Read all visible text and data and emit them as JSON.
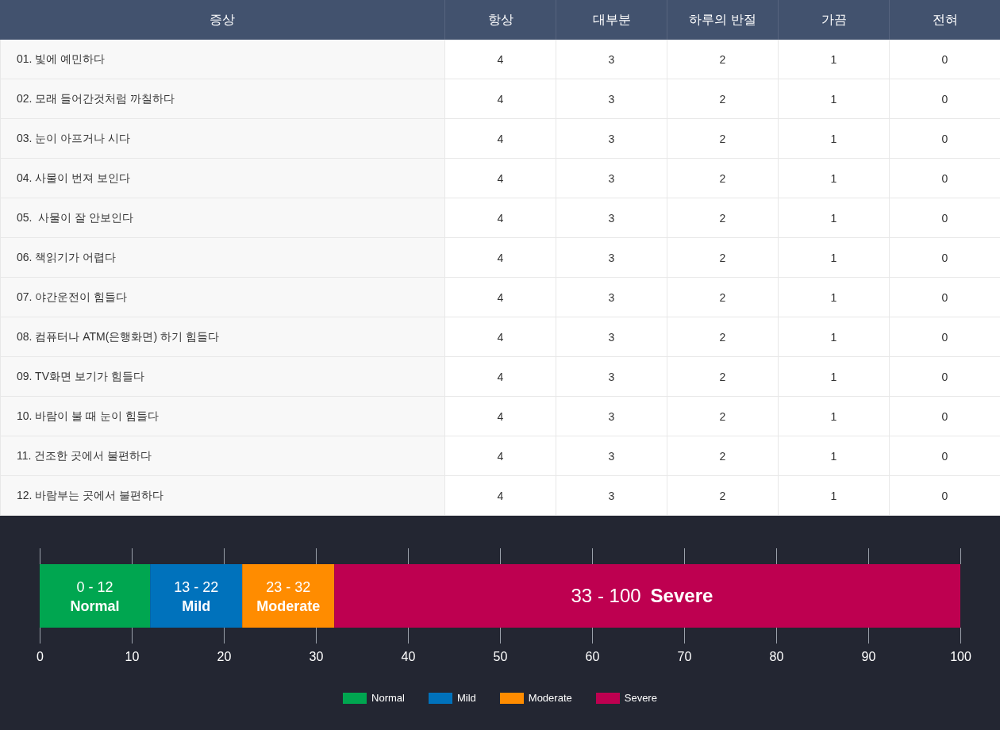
{
  "table": {
    "columns": [
      "증상",
      "항상",
      "대부분",
      "하루의 반절",
      "가끔",
      "전혀"
    ],
    "rows": [
      {
        "symptom": "01. 빛에 예민하다",
        "scores": [
          "4",
          "3",
          "2",
          "1",
          "0"
        ]
      },
      {
        "symptom": "02. 모래 들어간것처럼 까칠하다",
        "scores": [
          "4",
          "3",
          "2",
          "1",
          "0"
        ]
      },
      {
        "symptom": "03. 눈이 아프거나 시다",
        "scores": [
          "4",
          "3",
          "2",
          "1",
          "0"
        ]
      },
      {
        "symptom": "04. 사물이 번져 보인다",
        "scores": [
          "4",
          "3",
          "2",
          "1",
          "0"
        ]
      },
      {
        "symptom": "05.  사물이 잘 안보인다",
        "scores": [
          "4",
          "3",
          "2",
          "1",
          "0"
        ]
      },
      {
        "symptom": "06. 책읽기가 어렵다",
        "scores": [
          "4",
          "3",
          "2",
          "1",
          "0"
        ]
      },
      {
        "symptom": "07. 야간운전이 힘들다",
        "scores": [
          "4",
          "3",
          "2",
          "1",
          "0"
        ]
      },
      {
        "symptom": "08. 컴퓨터나 ATM(은행화면) 하기 힘들다",
        "scores": [
          "4",
          "3",
          "2",
          "1",
          "0"
        ]
      },
      {
        "symptom": "09. TV화면 보기가 힘들다",
        "scores": [
          "4",
          "3",
          "2",
          "1",
          "0"
        ]
      },
      {
        "symptom": "10. 바람이 불 때 눈이 힘들다",
        "scores": [
          "4",
          "3",
          "2",
          "1",
          "0"
        ]
      },
      {
        "symptom": "11. 건조한 곳에서 불편하다",
        "scores": [
          "4",
          "3",
          "2",
          "1",
          "0"
        ]
      },
      {
        "symptom": "12. 바람부는 곳에서 불편하다",
        "scores": [
          "4",
          "3",
          "2",
          "1",
          "0"
        ]
      }
    ]
  },
  "severity_chart": {
    "segments": [
      {
        "kind": "two-line",
        "range": "0 - 12",
        "label": "Normal"
      },
      {
        "kind": "two-line",
        "range": "13 - 22",
        "label": "Mild"
      },
      {
        "kind": "two-line",
        "range": "23 - 32",
        "label": "Moderate"
      },
      {
        "kind": "one-line",
        "range": "33 - 100",
        "label": "Severe"
      }
    ],
    "chart_data": {
      "type": "bar",
      "orientation": "horizontal",
      "stacked": true,
      "series": [
        {
          "name": "Normal",
          "color": "#00a650",
          "values": [
            12
          ]
        },
        {
          "name": "Mild",
          "color": "#0072bc",
          "values": [
            10
          ]
        },
        {
          "name": "Moderate",
          "color": "#ff8c00",
          "values": [
            10
          ]
        },
        {
          "name": "Severe",
          "color": "#be0050",
          "values": [
            68
          ]
        }
      ],
      "xlim": [
        0,
        100
      ],
      "xticks": [
        0,
        10,
        20,
        30,
        40,
        50,
        60,
        70,
        80,
        90,
        100
      ]
    }
  }
}
